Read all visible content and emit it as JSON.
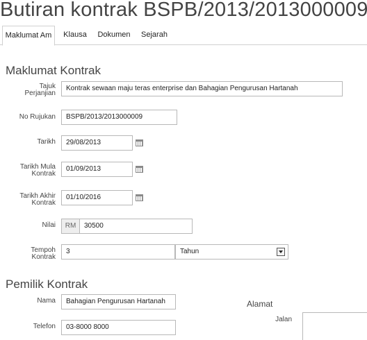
{
  "page": {
    "title": "Butiran kontrak BSPB/2013/2013000009"
  },
  "tabs": [
    {
      "label": "Maklumat Am",
      "active": true
    },
    {
      "label": "Klausa",
      "active": false
    },
    {
      "label": "Dokumen",
      "active": false
    },
    {
      "label": "Sejarah",
      "active": false
    }
  ],
  "maklumat_kontrak": {
    "heading": "Maklumat Kontrak",
    "tajuk_label_1": "Tajuk",
    "tajuk_label_2": "Perjanjian",
    "tajuk_value": "Kontrak sewaan maju teras enterprise dan Bahagian Pengurusan Hartanah",
    "no_rujukan_label": "No Rujukan",
    "no_rujukan_value": "BSPB/2013/2013000009",
    "tarikh_label": "Tarikh",
    "tarikh_value": "29/08/2013",
    "tarikh_mula_label_1": "Tarikh Mula",
    "tarikh_mula_label_2": "Kontrak",
    "tarikh_mula_value": "01/09/2013",
    "tarikh_akhir_label_1": "Tarikh Akhir",
    "tarikh_akhir_label_2": "Kontrak",
    "tarikh_akhir_value": "01/10/2016",
    "nilai_label": "Nilai",
    "nilai_prefix": "RM",
    "nilai_value": "30500",
    "tempoh_label_1": "Tempoh",
    "tempoh_label_2": "Kontrak",
    "tempoh_value": "3",
    "tempoh_unit": "Tahun"
  },
  "pemilik_kontrak": {
    "heading": "Pemilik Kontrak",
    "nama_label": "Nama",
    "nama_value": "Bahagian Pengurusan Hartanah",
    "telefon_label": "Telefon",
    "telefon_value": "03-8000 8000",
    "alamat_heading": "Alamat",
    "jalan_label": "Jalan",
    "jalan_value": ""
  }
}
